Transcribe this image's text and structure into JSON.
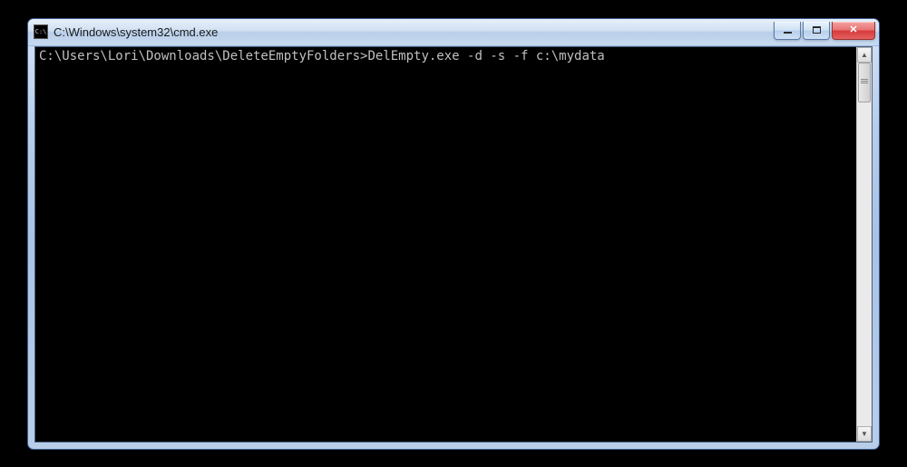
{
  "window": {
    "title": "C:\\Windows\\system32\\cmd.exe",
    "app_icon_text": "C:\\"
  },
  "terminal": {
    "prompt": "C:\\Users\\Lori\\Downloads\\DeleteEmptyFolders>",
    "command": "DelEmpty.exe -d -s -f c:\\mydata"
  },
  "controls": {
    "minimize_label": "Minimize",
    "maximize_label": "Maximize",
    "close_label": "Close"
  },
  "scrollbar": {
    "up_label": "Scroll up",
    "down_label": "Scroll down"
  },
  "colors": {
    "terminal_bg": "#000000",
    "terminal_fg": "#c0c0c0",
    "frame_blue": "#b8cde8",
    "close_red": "#d73a3a"
  }
}
